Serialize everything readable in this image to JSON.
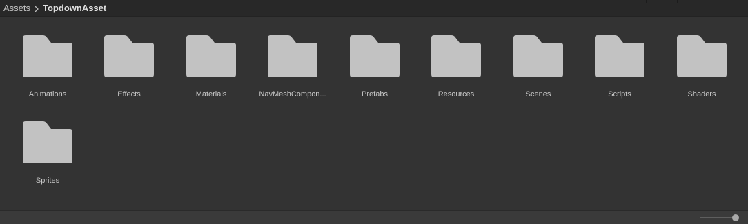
{
  "breadcrumb": {
    "root": "Assets",
    "separator": ">",
    "current": "TopdownAsset"
  },
  "folders": [
    {
      "name": "Animations",
      "icon": "folder-icon"
    },
    {
      "name": "Effects",
      "icon": "folder-icon"
    },
    {
      "name": "Materials",
      "icon": "folder-icon"
    },
    {
      "name": "NavMeshCompon...",
      "icon": "folder-icon"
    },
    {
      "name": "Prefabs",
      "icon": "folder-icon"
    },
    {
      "name": "Resources",
      "icon": "folder-icon"
    },
    {
      "name": "Scenes",
      "icon": "folder-icon"
    },
    {
      "name": "Scripts",
      "icon": "folder-icon"
    },
    {
      "name": "Shaders",
      "icon": "folder-icon"
    },
    {
      "name": "Sprites",
      "icon": "folder-icon"
    }
  ],
  "zoom": {
    "level": 1.0
  },
  "colors": {
    "background": "#333333",
    "folder": "#c2c2c2",
    "label": "#c8c8c8",
    "breadcrumb_bar": "#282828"
  }
}
